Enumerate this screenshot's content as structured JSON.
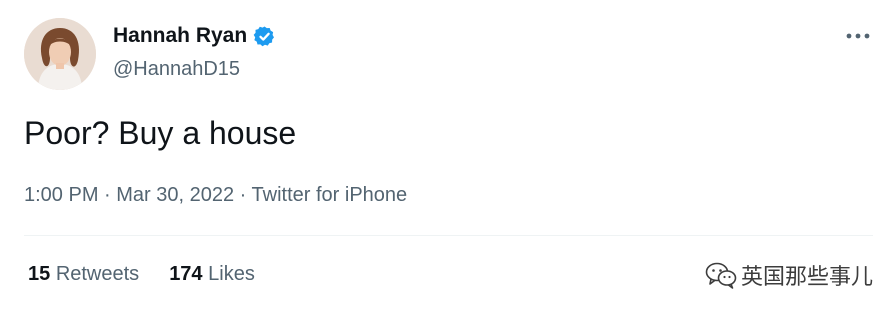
{
  "tweet": {
    "author": {
      "display_name": "Hannah Ryan",
      "handle": "@HannahD15",
      "verified": true
    },
    "text": "Poor? Buy a house",
    "meta": {
      "time": "1:00 PM",
      "separator": " · ",
      "date": "Mar 30, 2022",
      "source": "Twitter for iPhone"
    },
    "stats": {
      "retweets_count": "15",
      "retweets_label": "Retweets",
      "likes_count": "174",
      "likes_label": "Likes"
    },
    "more_icon": "more-horizontal-icon",
    "verified_icon": "verified-badge-icon"
  },
  "watermark": {
    "text": "英国那些事儿",
    "icon": "wechat-icon"
  },
  "colors": {
    "primary_text": "#0f1419",
    "secondary_text": "#536471",
    "verified_blue": "#1d9bf0",
    "divider": "#eff3f4"
  }
}
